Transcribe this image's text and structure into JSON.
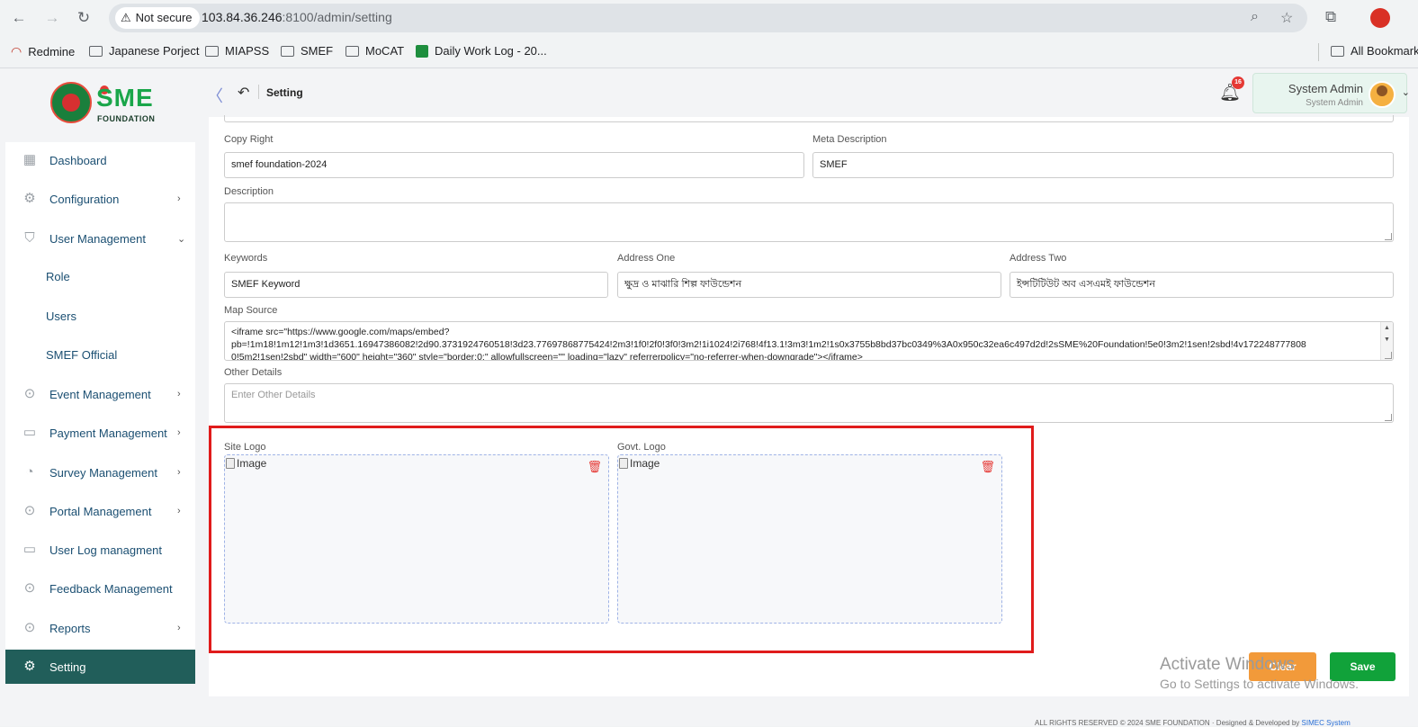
{
  "browser": {
    "security_label": "Not secure",
    "url_host": "103.84.36.246",
    "url_rest": ":8100/admin/setting",
    "bookmarks": [
      "Redmine",
      "Japanese Porject",
      "MIAPSS",
      "SMEF",
      "MoCAT",
      "Daily Work Log - 20...",
      "All Bookmarks"
    ]
  },
  "logo": {
    "brand": "SME",
    "sub": "FOUNDATION"
  },
  "sidebar": {
    "items": [
      {
        "label": "Dashboard"
      },
      {
        "label": "Configuration"
      },
      {
        "label": "User Management"
      },
      {
        "label": "Role"
      },
      {
        "label": "Users"
      },
      {
        "label": "SMEF Official"
      },
      {
        "label": "Event Management"
      },
      {
        "label": "Payment Management"
      },
      {
        "label": "Survey Management"
      },
      {
        "label": "Portal Management"
      },
      {
        "label": "User Log managment"
      },
      {
        "label": "Feedback Management"
      },
      {
        "label": "Reports"
      },
      {
        "label": "Setting"
      }
    ]
  },
  "header": {
    "breadcrumb": "Setting",
    "notification_count": "16",
    "user_name": "System Admin",
    "user_role": "System Admin"
  },
  "form": {
    "copyright_label": "Copy Right",
    "copyright_value": "smef foundation-2024",
    "meta_label": "Meta Description",
    "meta_value": "SMEF",
    "description_label": "Description",
    "description_value": "",
    "keywords_label": "Keywords",
    "keywords_value": "SMEF Keyword",
    "address_one_label": "Address One",
    "address_one_value": "ক্ষুদ্র ও মাঝারি শিল্প ফাউন্ডেশন",
    "address_two_label": "Address Two",
    "address_two_value": "ইন্সটিটিউট অব এসএমই ফাউন্ডেশন",
    "map_label": "Map Source",
    "map_line1": "<iframe src=\"https://www.google.com/maps/embed?",
    "map_line2": "pb=!1m18!1m12!1m3!1d3651.16947386082!2d90.3731924760518!3d23.77697868775424!2m3!1f0!2f0!3f0!3m2!1i1024!2i768!4f13.1!3m3!1m2!1s0x3755b8bd37bc0349%3A0x950c32ea6c497d2d!2sSME%20Foundation!5e0!3m2!1sen!2sbd!4v172248777808",
    "map_line3": "0!5m2!1sen!2sbd\" width=\"600\" height=\"360\" style=\"border:0;\" allowfullscreen=\"\" loading=\"lazy\" referrerpolicy=\"no-referrer-when-downgrade\"></iframe>",
    "other_label": "Other Details",
    "other_placeholder": "Enter Other Details",
    "site_logo_label": "Site Logo",
    "govt_logo_label": "Govt. Logo",
    "image_alt": "Image",
    "clear_label": "Clear",
    "save_label": "Save"
  },
  "watermark": {
    "line1": "Activate Windows",
    "line2": "Go to Settings to activate Windows."
  },
  "footer": {
    "text": "ALL RIGHTS RESERVED © 2024 SME FOUNDATION · Designed & Developed by",
    "link": "SIMEC System"
  },
  "colors": {
    "accent": "#215e5a",
    "save": "#11a23a",
    "clear": "#f29a3a",
    "highlight": "#e01b1b"
  }
}
